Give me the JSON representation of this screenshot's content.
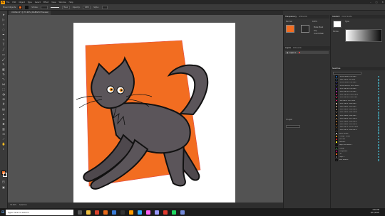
{
  "menubar": {
    "logo": "Ai",
    "items": [
      "File",
      "Edit",
      "Object",
      "Type",
      "Select",
      "Effect",
      "View",
      "Window",
      "Help"
    ]
  },
  "controlbar": {
    "selection_label": "Mixed Objects",
    "stroke_label": "Stroke:",
    "style_label": "Basic",
    "opacity_label": "Opacity:",
    "opacity_value": "100%",
    "style2_label": "Style:",
    "fill_color": "#f26d21"
  },
  "document": {
    "tab_title": "Untitled-1* @ 79.99% (RGB/GPU Preview)"
  },
  "panel_a": {
    "tabs": [
      "Transparency",
      "Artboards"
    ],
    "mode": "Normal",
    "opacity_value": "100%",
    "make_mask": "Make Mask",
    "clip": "Clip",
    "invert_mask": "Invert Mask",
    "layers_tabs": [
      "Layers",
      "Artboards"
    ],
    "layer_name": "Layer 1",
    "footer": "1 Layer"
  },
  "panel_b": {
    "tabs": [
      "Gradient",
      "Color Guide"
    ],
    "type_label": "Type:",
    "stroke_label": "Stroke:",
    "swatches_tabs": [
      "Swatches"
    ]
  },
  "swatches": [
    {
      "name": "C=100 M=50 Y=0 K=0",
      "color": "#1d5fa8"
    },
    {
      "name": "C=85 M=50 Y=0 K=0",
      "color": "#2e71b7"
    },
    {
      "name": "C=100 M=95 Y=5 K=0",
      "color": "#2b2c8a"
    },
    {
      "name": "C=100 M=100 Y=25 K=25",
      "color": "#2a1f65"
    },
    {
      "name": "C=75 M=100 Y=0 K=0",
      "color": "#5b2c8c"
    },
    {
      "name": "C=50 M=100 Y=0 K=0",
      "color": "#8c2a8d"
    },
    {
      "name": "C=35 M=100 Y=35 K=10",
      "color": "#9e2460"
    },
    {
      "name": "C=10 M=100 Y=50 K=0",
      "color": "#d4145a"
    },
    {
      "name": "C=0 M=95 Y=20 K=0",
      "color": "#e61f6f"
    },
    {
      "name": "C=25 M=25 Y=40 K=0",
      "color": "#c4b49a"
    },
    {
      "name": "C=40 M=45 Y=50 K=5",
      "color": "#9c8571"
    },
    {
      "name": "C=50 M=50 Y=60 K=25",
      "color": "#7a6a57"
    },
    {
      "name": "C=55 M=60 Y=65 K=40",
      "color": "#5f4b3f"
    },
    {
      "name": "C=25 M=40 Y=65 K=0",
      "color": "#c49a62"
    },
    {
      "name": "C=30 M=50 Y=75 K=10",
      "color": "#a77a44"
    },
    {
      "name": "C=35 M=60 Y=80 K=25",
      "color": "#8a5a2e"
    },
    {
      "name": "C=40 M=65 Y=90 K=35",
      "color": "#754a22"
    },
    {
      "name": "C=40 M=70 Y=100 K=50",
      "color": "#5e3713"
    },
    {
      "name": "C=50 M=70 Y=80 K=70",
      "color": "#3b2717"
    },
    {
      "name": "White, Black",
      "color": "#ffffff"
    },
    {
      "name": "Orange, Yellow",
      "color": "#f7941d"
    },
    {
      "name": "Fall Leaf",
      "color": "#c1272d"
    },
    {
      "name": "Summer",
      "color": "#fcee21"
    },
    {
      "name": "Super Soft Black...",
      "color": "#111111"
    },
    {
      "name": "Foliage",
      "color": "#39b54a"
    },
    {
      "name": "Pompadour",
      "color": "#9e005d"
    },
    {
      "name": "Cat",
      "color": "#f26d21"
    },
    {
      "name": "Layer 2",
      "color": "#5b555a"
    },
    {
      "name": "New Swatch",
      "color": "#222222"
    }
  ],
  "statusbar": {
    "zoom": "79.99%",
    "tool": "Selection"
  },
  "taskbar": {
    "search_placeholder": "Type here to search",
    "time": "4:06 PM",
    "date": "8/11/2020"
  },
  "canvas": {
    "background_shape_color": "#f26d21",
    "cat_body_color": "#5b555a",
    "outline_color": "#111111"
  }
}
